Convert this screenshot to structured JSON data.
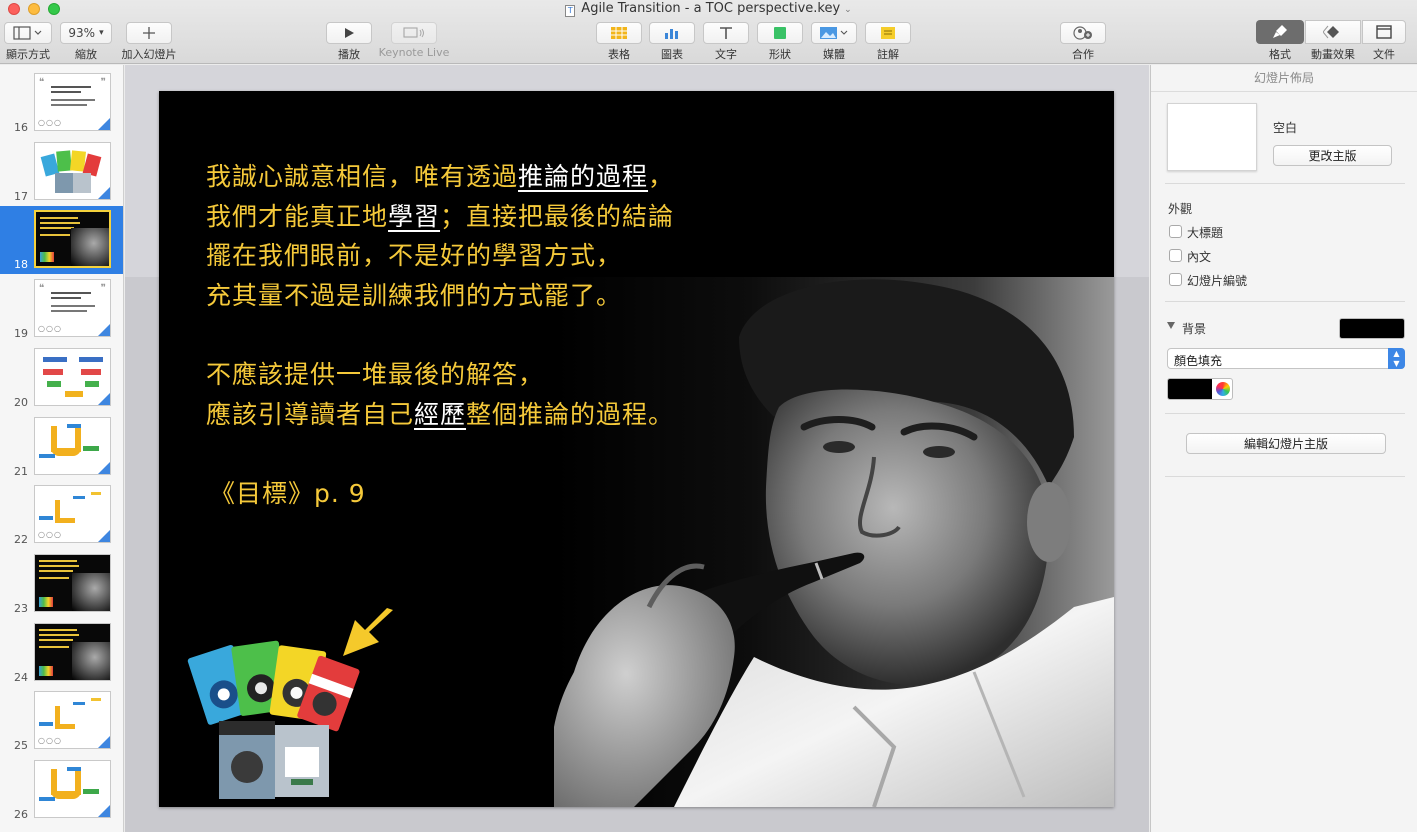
{
  "window": {
    "title": "Agile Transition - a TOC perspective.key",
    "doc_icon_glyph": "T"
  },
  "toolbar": {
    "view_label": "顯示方式",
    "zoom_value": "93%",
    "zoom_label": "縮放",
    "add_slide_label": "加入幻燈片",
    "play_label": "播放",
    "keynote_live_label": "Keynote Live",
    "table_label": "表格",
    "chart_label": "圖表",
    "text_label": "文字",
    "shape_label": "形狀",
    "media_label": "媒體",
    "comment_label": "註解",
    "collaborate_label": "合作",
    "format_label": "格式",
    "animate_label": "動畫效果",
    "document_label": "文件"
  },
  "navigator": {
    "slides": [
      {
        "number": "16",
        "variant": "light-quote",
        "selected": false
      },
      {
        "number": "17",
        "variant": "books",
        "selected": false
      },
      {
        "number": "18",
        "variant": "dark-photo",
        "selected": true
      },
      {
        "number": "19",
        "variant": "light-quote",
        "selected": false
      },
      {
        "number": "20",
        "variant": "diagram",
        "selected": false
      },
      {
        "number": "21",
        "variant": "u-diagram",
        "selected": false
      },
      {
        "number": "22",
        "variant": "u-diagram-small",
        "selected": false
      },
      {
        "number": "23",
        "variant": "dark-photo",
        "selected": false
      },
      {
        "number": "24",
        "variant": "dark-photo",
        "selected": false
      },
      {
        "number": "25",
        "variant": "u-diagram-small",
        "selected": false
      },
      {
        "number": "26",
        "variant": "u-diagram",
        "selected": false
      }
    ]
  },
  "slide": {
    "paragraph1": [
      [
        {
          "t": "我誠心誠意相信，唯有透過"
        },
        {
          "t": "推論的過程",
          "u": true
        },
        {
          "t": "，"
        }
      ],
      [
        {
          "t": "我們才能真正地"
        },
        {
          "t": "學習",
          "u": true
        },
        {
          "t": "；直接把最後的結論"
        }
      ],
      [
        {
          "t": "擺在我們眼前，不是好的學習方式，"
        }
      ],
      [
        {
          "t": "充其量不過是訓練我們的方式罷了。"
        }
      ]
    ],
    "paragraph2": [
      [
        {
          "t": "不應該提供一堆最後的解答，"
        }
      ],
      [
        {
          "t": "應該引導讀者自己"
        },
        {
          "t": "經歷",
          "u": true
        },
        {
          "t": "整個推論的過程。"
        }
      ]
    ],
    "source": "《目標》p. 9",
    "text_color": "#f5c93a",
    "highlight_color": "#ffffff"
  },
  "inspector": {
    "title": "幻燈片佈局",
    "master_name": "空白",
    "change_master_label": "更改主版",
    "appearance_label": "外觀",
    "checkboxes": {
      "title": "大標題",
      "body": "內文",
      "slide_number": "幻燈片編號"
    },
    "background_label": "背景",
    "fill_type": "顏色填充",
    "fill_color": "#000000",
    "edit_master_label": "編輯幻燈片主版"
  }
}
